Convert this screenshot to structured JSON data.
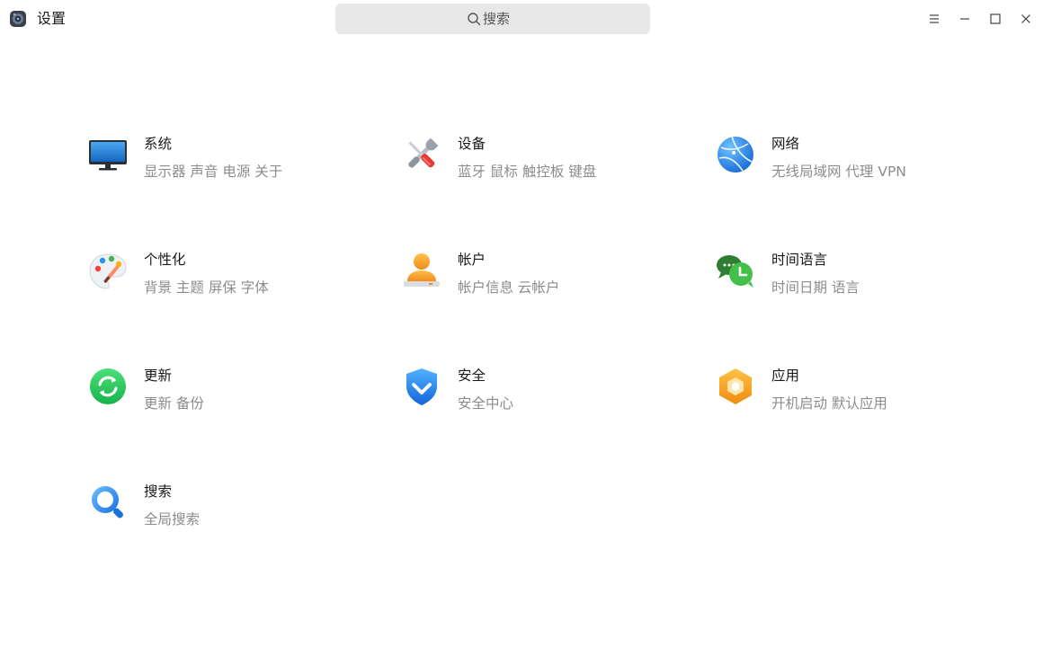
{
  "window": {
    "title": "设置",
    "search": {
      "placeholder": "搜索"
    },
    "controls": [
      "menu-icon",
      "minimize-icon",
      "maximize-icon",
      "close-icon"
    ]
  },
  "categories": [
    {
      "title": "系统",
      "desc": "显示器 声音 电源 关于",
      "icon": "monitor-icon"
    },
    {
      "title": "设备",
      "desc": "蓝牙 鼠标 触控板 键盘",
      "icon": "tools-icon"
    },
    {
      "title": "网络",
      "desc": "无线局域网 代理 VPN",
      "icon": "globe-icon"
    },
    {
      "title": "个性化",
      "desc": "背景 主题 屏保 字体",
      "icon": "palette-icon"
    },
    {
      "title": "帐户",
      "desc": "帐户信息 云帐户",
      "icon": "user-icon"
    },
    {
      "title": "时间语言",
      "desc": "时间日期 语言",
      "icon": "clock-chat-icon"
    },
    {
      "title": "更新",
      "desc": "更新 备份",
      "icon": "refresh-icon"
    },
    {
      "title": "安全",
      "desc": "安全中心",
      "icon": "shield-icon"
    },
    {
      "title": "应用",
      "desc": "开机启动 默认应用",
      "icon": "apps-hexagon-icon"
    },
    {
      "title": "搜索",
      "desc": "全局搜索",
      "icon": "magnifier-icon"
    }
  ],
  "colors": {
    "accent": "#1e88e5",
    "search_bg": "#e8e8e8",
    "desc_text": "#8c8c8c"
  }
}
